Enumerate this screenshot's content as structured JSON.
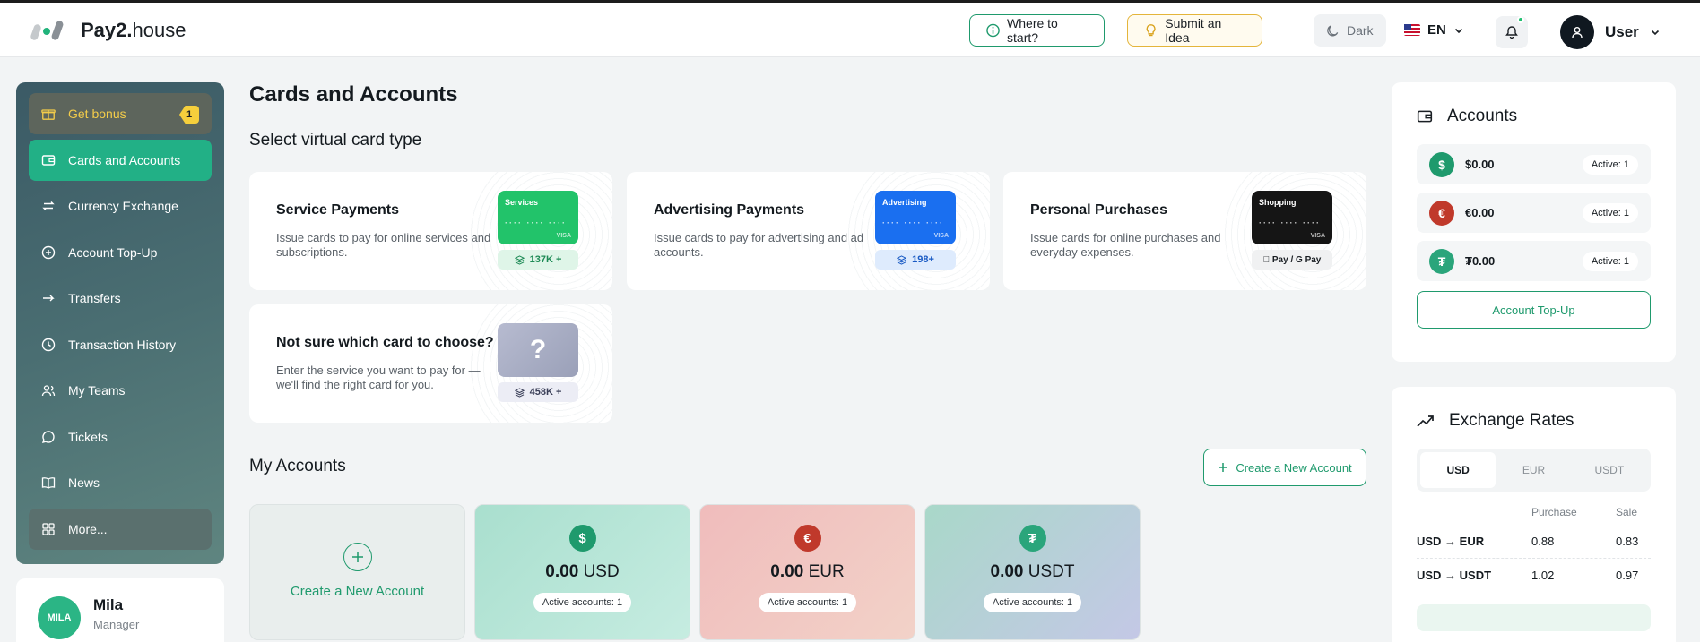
{
  "header": {
    "logo_bold": "Pay2.",
    "logo_rest": "house",
    "where_label": "Where to start?",
    "idea_label": "Submit an Idea",
    "theme_label": "Dark",
    "lang": "EN",
    "user_name": "User"
  },
  "sidebar": {
    "items": [
      {
        "label": "Get bonus",
        "badge": "1"
      },
      {
        "label": "Cards and Accounts"
      },
      {
        "label": "Currency Exchange"
      },
      {
        "label": "Account Top-Up"
      },
      {
        "label": "Transfers"
      },
      {
        "label": "Transaction History"
      },
      {
        "label": "My Teams"
      },
      {
        "label": "Tickets"
      },
      {
        "label": "News"
      },
      {
        "label": "More..."
      }
    ],
    "manager": {
      "name": "Mila",
      "role": "Manager",
      "avatar_text": "MILA"
    }
  },
  "main": {
    "title": "Cards and Accounts",
    "subtitle": "Select virtual card type",
    "card_types": [
      {
        "title": "Service Payments",
        "desc": "Issue cards to pay for online services and subscriptions.",
        "card_label": "Services",
        "badge": "137K +",
        "color": "#22c36a"
      },
      {
        "title": "Advertising Payments",
        "desc": "Issue cards to pay for advertising and ad accounts.",
        "card_label": "Advertising",
        "badge": "198+",
        "color": "#1a6ff0"
      },
      {
        "title": "Personal Purchases",
        "desc": "Issue cards for online purchases and everyday expenses.",
        "card_label": "Shopping",
        "badge": " Pay / G Pay",
        "color": "#151515"
      },
      {
        "title": "Not sure which card to choose?",
        "desc": "Enter the service you want to pay for — we'll find the right card for you.",
        "card_label": "?",
        "badge": "458K +",
        "color": "#a8adc4"
      }
    ],
    "card_dots": "···· ···· ····",
    "card_visa": "VISA",
    "my_accounts_title": "My Accounts",
    "create_label": "Create a New Account",
    "accounts": [
      {
        "amount": "0.00",
        "currency": "USD",
        "symbol": "$",
        "active": "Active accounts: 1"
      },
      {
        "amount": "0.00",
        "currency": "EUR",
        "symbol": "€",
        "active": "Active accounts: 1"
      },
      {
        "amount": "0.00",
        "currency": "USDT",
        "symbol": "₮",
        "active": "Active accounts: 1"
      }
    ],
    "create_tile_label": "Create a New Account"
  },
  "right": {
    "accounts_title": "Accounts",
    "accounts": [
      {
        "symbol": "$",
        "value": "$0.00",
        "active": "Active: 1",
        "color": "#1f9a6d"
      },
      {
        "symbol": "€",
        "value": "€0.00",
        "active": "Active: 1",
        "color": "#c0392b"
      },
      {
        "symbol": "₮",
        "value": "₮0.00",
        "active": "Active: 1",
        "color": "#2aa57b"
      }
    ],
    "topup_label": "Account Top-Up",
    "rates_title": "Exchange Rates",
    "tabs": [
      "USD",
      "EUR",
      "USDT"
    ],
    "rate_headers": [
      "Purchase",
      "Sale"
    ],
    "rates": [
      {
        "pair": "USD → EUR",
        "purchase": "0.88",
        "sale": "0.83"
      },
      {
        "pair": "USD → USDT",
        "purchase": "1.02",
        "sale": "0.97"
      }
    ]
  }
}
